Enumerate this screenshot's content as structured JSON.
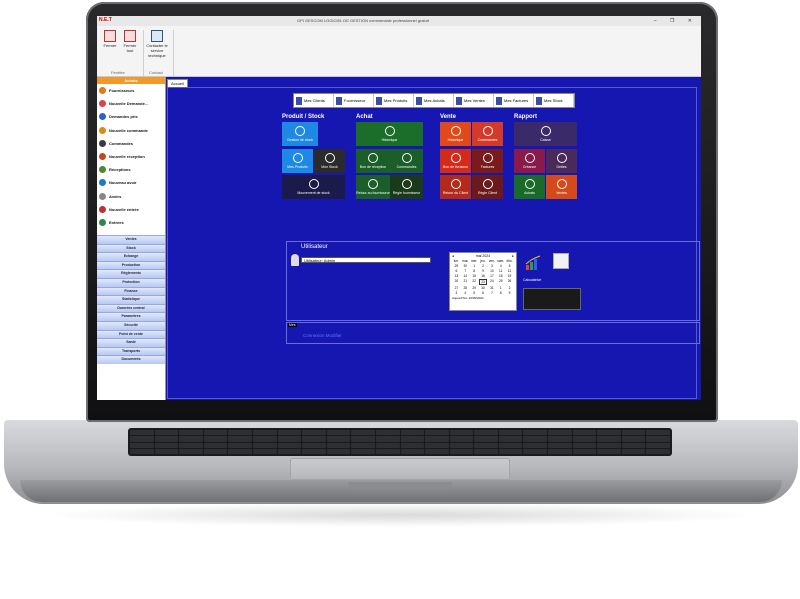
{
  "titlebar": {
    "logo": "N.E.T",
    "title": "GPI GESCOM LOGICIEL DE GESTION commerciale professionnel gratuit",
    "window_controls": "– ❐ ✕"
  },
  "ribbon": {
    "buttons": [
      {
        "label": "Fermer"
      },
      {
        "label": "Fermer tout"
      },
      {
        "label": "Contacter le service technique"
      }
    ],
    "groups": [
      "Fenêtre",
      "Contact"
    ]
  },
  "sidebar": {
    "header": "Achats",
    "items": [
      {
        "label": "Fournisseurs",
        "color": "#e07a1a"
      },
      {
        "label": "Nouvelle Demande…",
        "color": "#d94444"
      },
      {
        "label": "Demandes prix",
        "color": "#2a62c8"
      },
      {
        "label": "Nouvelle commande",
        "color": "#d98a1a"
      },
      {
        "label": "Commandes",
        "color": "#3a3a3a"
      },
      {
        "label": "Nouvelle réception",
        "color": "#c04a1a"
      },
      {
        "label": "Réceptions",
        "color": "#4a8a2a"
      },
      {
        "label": "Nouveau avoir",
        "color": "#1a7ac8"
      },
      {
        "label": "Avoirs",
        "color": "#888888"
      },
      {
        "label": "Nouvelle entrée",
        "color": "#c03030"
      },
      {
        "label": "Entrées",
        "color": "#2a8a4a"
      }
    ],
    "categories": [
      "Ventes",
      "Stock",
      "Echange",
      "Production",
      "Règlements",
      "Protection",
      "Finance",
      "Statistique",
      "Données central",
      "Paramètres",
      "Sécurité",
      "Point de vente",
      "Santé",
      "Transports",
      "Documents"
    ]
  },
  "tabs": [
    "Accueil"
  ],
  "toolbar": [
    "Mes Clients",
    "Fournisseur",
    "Mes Produits",
    "Mes Achats",
    "Mes Ventes",
    "Mes Factures",
    "Mes Stock"
  ],
  "sections": {
    "produit": "Produit / Stock",
    "achat": "Achat",
    "vente": "Vente",
    "rapport": "Rapport"
  },
  "tiles": {
    "produit": [
      {
        "label": "Gestion de stock",
        "color": "#1e88e5"
      },
      {
        "label": "Mes Produits",
        "color": "#1e88e5"
      },
      {
        "label": "Mon Stock",
        "color": "#2b2b2b"
      },
      {
        "label": "Mouvement de stock",
        "color": "#1b1b4b"
      }
    ],
    "achat": [
      {
        "label": "Historique",
        "color": "#1b6e2a"
      },
      {
        "label": "Bon de réception",
        "color": "#1b5e2a"
      },
      {
        "label": "Commandes",
        "color": "#1b5e2a"
      },
      {
        "label": "Retour au fournisseur",
        "color": "#1b5e2a"
      },
      {
        "label": "Règle fournisseur",
        "color": "#1b3a1a"
      }
    ],
    "vente": [
      {
        "label": "Historique",
        "color": "#e04a1a"
      },
      {
        "label": "Commandes",
        "color": "#d43a2a"
      },
      {
        "label": "Bon de livraison",
        "color": "#d42a1a"
      },
      {
        "label": "Factures",
        "color": "#7a1a1a"
      },
      {
        "label": "Retour du Client",
        "color": "#b42a1a"
      },
      {
        "label": "Règle Client",
        "color": "#6a1a1a"
      }
    ],
    "rapport": [
      {
        "label": "Caisse",
        "color": "#3a2a6a"
      },
      {
        "label": "Créance",
        "color": "#8a1a4a"
      },
      {
        "label": "Dettes",
        "color": "#4a2a5a"
      },
      {
        "label": "Achats",
        "color": "#1a6a2a"
      },
      {
        "label": "Ventes",
        "color": "#d44a1a"
      }
    ]
  },
  "user": {
    "title": "Utilisateur",
    "name": "Utilisateur: Admin"
  },
  "calendar": {
    "month": "mai 2024",
    "prev": "◂",
    "next": "▸",
    "weekdays": [
      "lun.",
      "mar.",
      "mer.",
      "jeu.",
      "ven.",
      "sam.",
      "dim."
    ],
    "days": [
      "29",
      "30",
      "1",
      "2",
      "3",
      "4",
      "5",
      "6",
      "7",
      "8",
      "9",
      "10",
      "11",
      "12",
      "13",
      "14",
      "15",
      "16",
      "17",
      "18",
      "19",
      "20",
      "21",
      "22",
      "23",
      "24",
      "25",
      "26",
      "27",
      "28",
      "29",
      "30",
      "31",
      "1",
      "2",
      "3",
      "4",
      "5",
      "6",
      "7",
      "8",
      "9"
    ],
    "today": "Aujourd'hui: 23/05/2024"
  },
  "calculator": "Calculatrice",
  "bottom": {
    "tag": "Mes",
    "link": "Connexion Modifier"
  }
}
